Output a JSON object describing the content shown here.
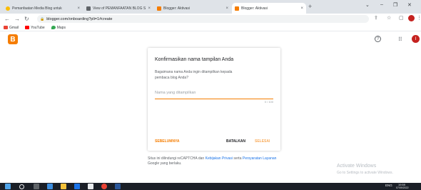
{
  "tabs": [
    {
      "label": "Pemanfaatan Media Blog untuk",
      "icon": "smile-favicon",
      "color": "#fbbc04"
    },
    {
      "label": "View of PEMANFAATAN BLOG S",
      "icon": "pdf-favicon",
      "color": "#5f6368"
    },
    {
      "label": "Blogger: Aktivasi",
      "icon": "blogger-favicon",
      "color": "#f57d00"
    },
    {
      "label": "Blogger: Aktivasi",
      "icon": "blogger-favicon",
      "color": "#f57d00"
    }
  ],
  "url": "blogger.com/onboarding?pli=1#create",
  "bookmarks": [
    {
      "label": "Gmail",
      "color": "#ea4335"
    },
    {
      "label": "YouTube",
      "color": "#ff0000"
    },
    {
      "label": "Maps",
      "color": "#34a853"
    }
  ],
  "app": {
    "logo_letter": "B",
    "avatar_letter": "I"
  },
  "dialog": {
    "title": "Konfirmasikan nama tampilan Anda",
    "subtitle": "Bagaimana nama Anda ingin ditampilkan kepada pembaca blog Anda?",
    "input_placeholder": "Nama yang ditampilkan",
    "counter": "0 / 100",
    "prev_label": "SEBELUMNYA",
    "cancel_label": "BATALKAN",
    "next_label": "SELESAI"
  },
  "recaptcha": {
    "prefix": "Situs ini dilindungi reCAPTCHA dan",
    "privacy_link": "Kebijakan Privasi",
    "middle": "serta",
    "terms_link": "Persyaratan Layanan",
    "suffix": "Google yang berlaku."
  },
  "watermark": {
    "line1": "Activate Windows",
    "line2": "Go to Settings to activate Windows."
  },
  "tray": {
    "lang": "ENG",
    "time": "19:59",
    "date": "07/09/2022"
  },
  "colors": {
    "accent": "#f57d00",
    "link": "#1a73e8"
  }
}
